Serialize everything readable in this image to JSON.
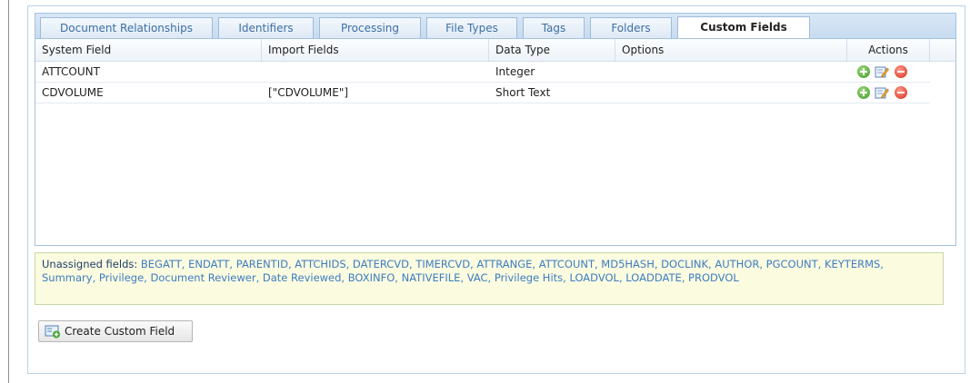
{
  "tabs": [
    {
      "label": "Document Relationships"
    },
    {
      "label": "Identifiers"
    },
    {
      "label": "Processing"
    },
    {
      "label": "File Types"
    },
    {
      "label": "Tags"
    },
    {
      "label": "Folders"
    },
    {
      "label": "Custom Fields",
      "active": true
    }
  ],
  "grid": {
    "columns": [
      "System Field",
      "Import Fields",
      "Data Type",
      "Options",
      "Actions"
    ],
    "rows": [
      {
        "system_field": "ATTCOUNT",
        "import_fields": "",
        "data_type": "Integer",
        "options": ""
      },
      {
        "system_field": "CDVOLUME",
        "import_fields": "[\"CDVOLUME\"]",
        "data_type": "Short Text",
        "options": ""
      }
    ]
  },
  "unassigned": {
    "label": "Unassigned fields:",
    "fields": "BEGATT, ENDATT, PARENTID, ATTCHIDS, DATERCVD, TIMERCVD, ATTRANGE, ATTCOUNT, MD5HASH, DOCLINK, AUTHOR, PGCOUNT, KEYTERMS, Summary, Privilege, Document Reviewer, Date Reviewed, BOXINFO, NATIVEFILE, VAC, Privilege Hits, LOADVOL, LOADDATE, PRODVOL"
  },
  "create_button": {
    "label": "Create Custom Field"
  },
  "icons": {
    "add": "add-circle-icon",
    "edit": "edit-note-icon",
    "delete": "delete-circle-icon",
    "create": "custom-field-add-icon"
  },
  "colors": {
    "tab_text": "#3d6fa6",
    "link_text": "#3d7cc0",
    "panel_bg": "#fbfbe0",
    "add_green": "#3f9a2a",
    "delete_red": "#d22e1c"
  }
}
